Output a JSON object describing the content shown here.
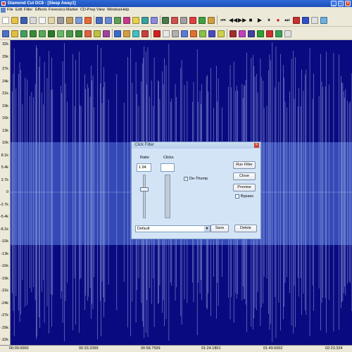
{
  "window": {
    "title": "Diamond Cut DC8 - [Sleep Away1]",
    "controls": {
      "minimize": "_",
      "maximize": "□",
      "close": "×"
    }
  },
  "menu": {
    "items": [
      "File",
      "Edit",
      "Filter",
      "Effects",
      "Forensics",
      "Marker",
      "CD-Prep",
      "View",
      "Window",
      "Help"
    ]
  },
  "toolbar": {
    "transport_glyphs": [
      "⏮",
      "◀◀",
      "▶▶",
      "■",
      "▶",
      "⏸",
      "●",
      "⏭"
    ]
  },
  "waveform": {
    "y_labels": [
      "32k",
      "29k",
      "27k",
      "24k",
      "21k",
      "19k",
      "16k",
      "13k",
      "10k",
      "8.1k",
      "5.4k",
      "2.7k",
      "0",
      "-2.7k",
      "-5.4k",
      "-8.1k",
      "-10k",
      "-13k",
      "-16k",
      "-19k",
      "-21k",
      "-24k",
      "-27k",
      "-29k",
      "-32k"
    ],
    "timeline_labels": [
      "00:00.0000",
      "00:33.3399",
      "00:58.7599",
      "01:24.1801",
      "01:49.6002",
      "02:23.324"
    ],
    "colors": {
      "background": "#0a0a80",
      "wave": "#9fb3e8",
      "band": "#3d55c0"
    }
  },
  "dialog": {
    "title": "Click Filter",
    "ratio_label": "Ratio",
    "ratio_value": "1.94",
    "clicks_label": "Clicks",
    "clicks_value": "",
    "dethump_label": "De-Thump",
    "dethump_checked": "✓",
    "run_filter": "Run Filter",
    "close": "Close",
    "preview": "Preview",
    "bypass": "Bypass",
    "preset": "Default",
    "save": "Save",
    "delete": "Delete"
  }
}
